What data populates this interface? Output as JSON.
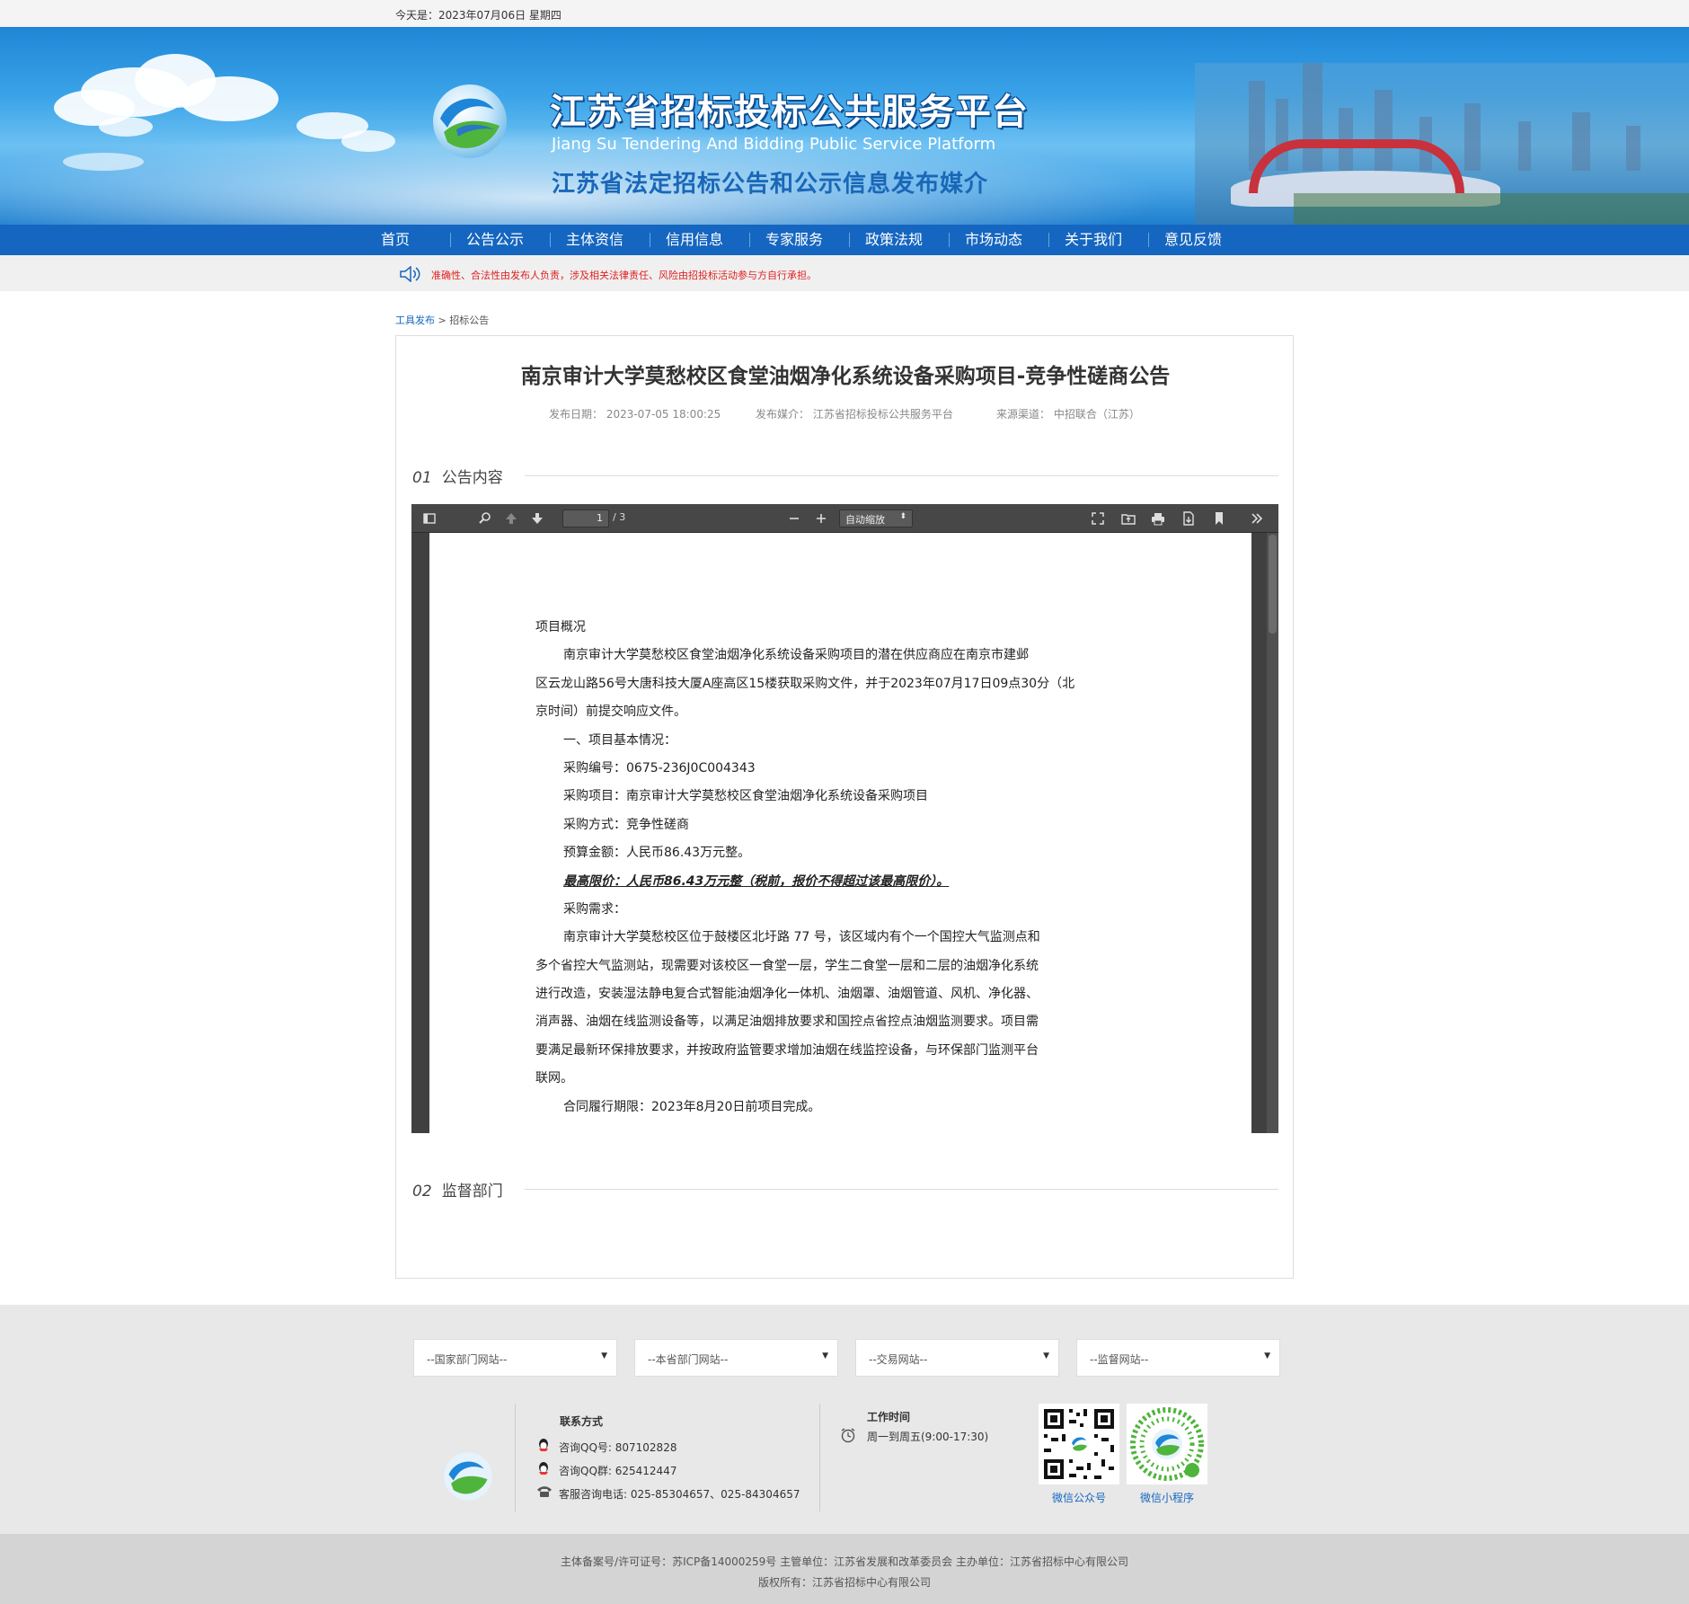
{
  "topbar": {
    "date": "今天是：2023年07月06日 星期四"
  },
  "banner": {
    "title_cn": "江苏省招标投标公共服务平台",
    "title_en": "Jiang Su Tendering And Bidding Public Service Platform",
    "slogan": "江苏省法定招标公告和公示信息发布媒介"
  },
  "nav": {
    "items": [
      "首页",
      "公告公示",
      "主体资信",
      "信用信息",
      "专家服务",
      "政策法规",
      "市场动态",
      "关于我们",
      "意见反馈"
    ]
  },
  "notice": {
    "text": "准确性、合法性由发布人负责，涉及相关法律责任、风险由招投标活动参与方自行承担。"
  },
  "breadcrumb": {
    "home": "工具发布",
    "sep": ">",
    "current": "招标公告"
  },
  "article": {
    "title": "南京审计大学莫愁校区食堂油烟净化系统设备采购项目-竞争性磋商公告",
    "publish_date": "发布日期：  2023-07-05 18:00:25",
    "media": "发布媒介：  江苏省招标投标公共服务平台",
    "source": "来源渠道：  中招联合（江苏）"
  },
  "sections": [
    {
      "num": "01",
      "label": "公告内容"
    },
    {
      "num": "02",
      "label": "监督部门"
    }
  ],
  "pdf": {
    "page_current": "1",
    "page_total": "/ 3",
    "zoom": "自动缩放",
    "lines": [
      {
        "text": "项目概况",
        "style": ""
      },
      {
        "text": "南京审计大学莫愁校区食堂油烟净化系统设备采购项目的潜在供应商应在南京市建邺",
        "style": "ind"
      },
      {
        "text": "区云龙山路56号大唐科技大厦A座高区15楼获取采购文件，并于2023年07月17日09点30分（北",
        "style": ""
      },
      {
        "text": "京时间）前提交响应文件。",
        "style": ""
      },
      {
        "text": "一、项目基本情况：",
        "style": "ind"
      },
      {
        "text": "采购编号：0675-236J0C004343",
        "style": "ind"
      },
      {
        "text": "采购项目：南京审计大学莫愁校区食堂油烟净化系统设备采购项目",
        "style": "ind"
      },
      {
        "text": "采购方式：竞争性磋商",
        "style": "ind"
      },
      {
        "text": "预算金额：人民币86.43万元整。",
        "style": "ind"
      },
      {
        "text": "最高限价：人民币86.43万元整（税前，报价不得超过该最高限价）。",
        "style": "ind em"
      },
      {
        "text": "采购需求：",
        "style": "ind"
      },
      {
        "text": "南京审计大学莫愁校区位于鼓楼区北圩路 77 号，该区域内有个一个国控大气监测点和",
        "style": "ind"
      },
      {
        "text": "多个省控大气监测站，现需要对该校区一食堂一层，学生二食堂一层和二层的油烟净化系统",
        "style": ""
      },
      {
        "text": "进行改造，安装湿法静电复合式智能油烟净化一体机、油烟罩、油烟管道、风机、净化器、",
        "style": ""
      },
      {
        "text": "消声器、油烟在线监测设备等，以满足油烟排放要求和国控点省控点油烟监测要求。项目需",
        "style": ""
      },
      {
        "text": "要满足最新环保排放要求，并按政府监管要求增加油烟在线监控设备，与环保部门监测平台",
        "style": ""
      },
      {
        "text": "联网。",
        "style": ""
      },
      {
        "text": "合同履行期限：2023年8月20日前项目完成。",
        "style": "ind"
      }
    ]
  },
  "footer": {
    "selects": [
      "--国家部门网站--",
      "--本省部门网站--",
      "--交易网站--",
      "--监督网站--"
    ],
    "contact_title": "联系方式",
    "qq": "咨询QQ号:  807102828",
    "qq_group": "咨询QQ群:  625412447",
    "phone": "客服咨询电话:  025-85304657、025-84304657",
    "hours_title": "工作时间",
    "hours": "周一到周五(9:00-17:30)",
    "qr1_label": "微信公众号",
    "qr2_label": "微信小程序"
  },
  "copyright": {
    "line1": "主体备案号/许可证号：苏ICP备14000259号 主管单位：江苏省发展和改革委员会 主办单位：江苏省招标中心有限公司",
    "line2": "版权所有：江苏省招标中心有限公司"
  },
  "colors": {
    "nav": "#1566c0",
    "notice_text": "#e02020",
    "link": "#1566c0"
  }
}
